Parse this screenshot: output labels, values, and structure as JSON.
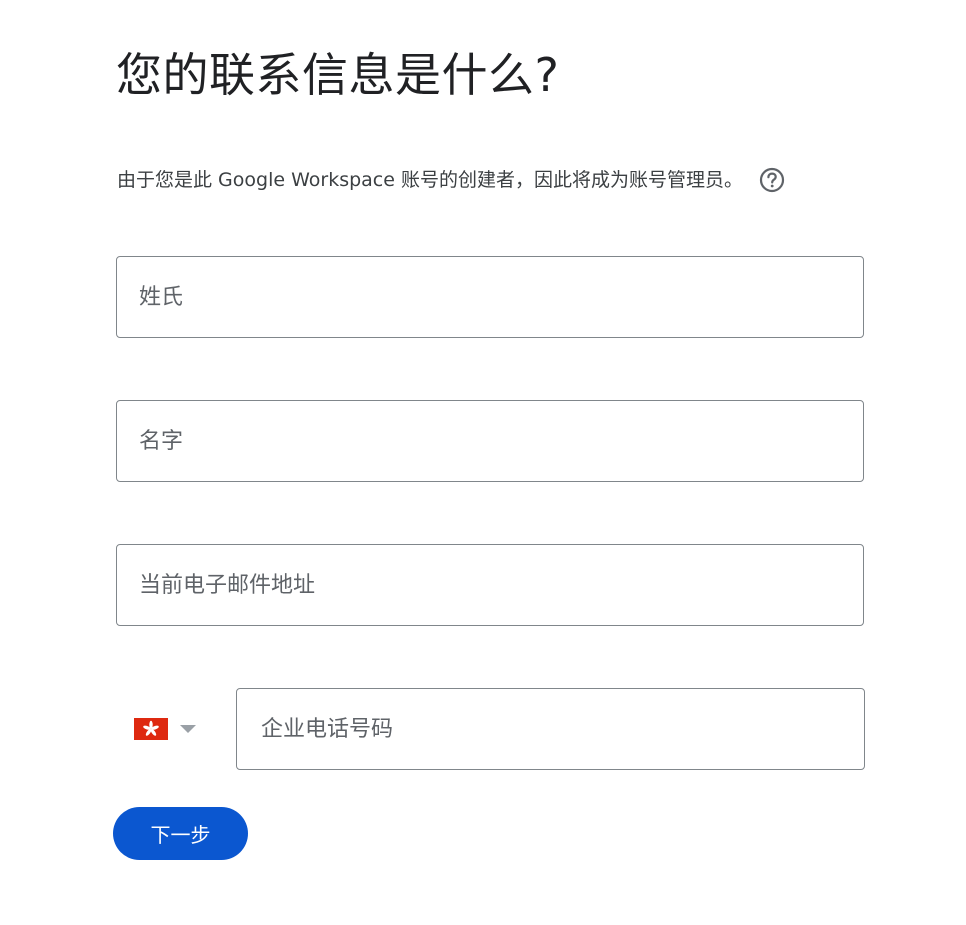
{
  "page": {
    "title": "您的联系信息是什么?",
    "subtitle": "由于您是此 Google Workspace 账号的创建者，因此将成为账号管理员。",
    "help_icon": "help-circle-icon"
  },
  "form": {
    "last_name": {
      "placeholder": "姓氏",
      "value": ""
    },
    "first_name": {
      "placeholder": "名字",
      "value": ""
    },
    "email": {
      "placeholder": "当前电子邮件地址",
      "value": ""
    },
    "phone": {
      "country_flag": "hong-kong-flag-icon",
      "dropdown_icon": "caret-down-icon",
      "placeholder": "企业电话号码",
      "value": ""
    }
  },
  "actions": {
    "next_label": "下一步"
  },
  "colors": {
    "primary_button": "#0b57d0",
    "field_border": "#80868b",
    "title_text": "#202124",
    "flag_red": "#de2910"
  }
}
